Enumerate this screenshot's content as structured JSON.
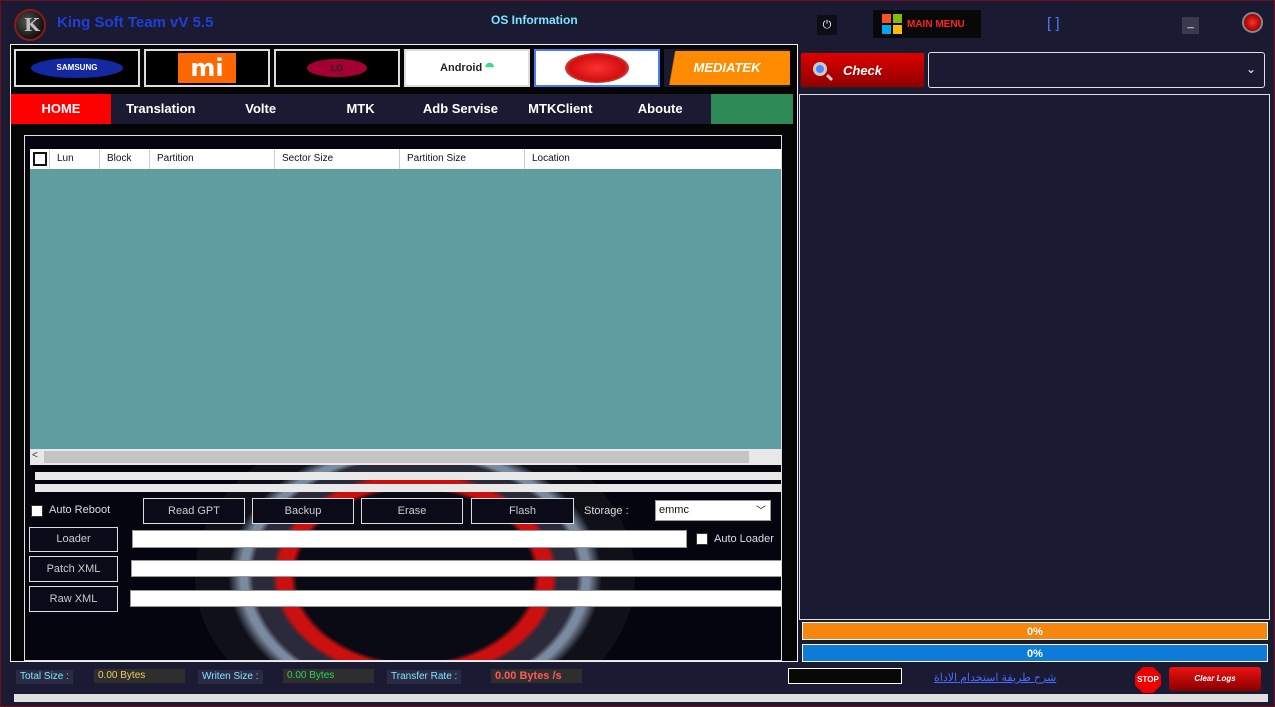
{
  "title_bar": {
    "app_title": "King Soft Team vV 5.5",
    "os_info": "OS Information",
    "main_menu_label": "MAIN MENU",
    "bracket_label": "[ ]",
    "minimize_label": "_",
    "power_glyph": "⏻"
  },
  "brands": {
    "samsung": "SAMSUNG",
    "xiaomi": "mi",
    "lg": "LG",
    "android": "Android",
    "mediatek": "MEDIATEK"
  },
  "nav": {
    "tabs": [
      "HOME",
      "Translation",
      "Volte",
      "MTK",
      "Adb Servise",
      "MTKClient",
      "Aboute"
    ],
    "active_index": 0
  },
  "partition_table": {
    "columns": [
      "Lun",
      "Block",
      "Partition",
      "Sector Size",
      "Partition Size",
      "Location"
    ],
    "rows": []
  },
  "controls": {
    "auto_reboot_label": "Auto Reboot",
    "read_gpt": "Read GPT",
    "backup": "Backup",
    "erase": "Erase",
    "flash": "Flash",
    "storage_label": "Storage :",
    "storage_value": "emmc",
    "loader": "Loader",
    "auto_loader_label": "Auto Loader",
    "patch_xml": "Patch XML",
    "raw_xml": "Raw XML",
    "loader_path": "",
    "patch_path": "",
    "raw_path": ""
  },
  "right_panel": {
    "check_label": "Check",
    "device_dropdown_value": "",
    "progress1_label": "0%",
    "progress1_value": 0,
    "progress2_label": "0%",
    "progress2_value": 0
  },
  "status": {
    "total_size_label": "Total Size :",
    "total_size_value": "0.00 Bytes",
    "written_size_label": "Writen Size :",
    "written_size_value": "0.00 Bytes",
    "transfer_rate_label": "Transfer Rate :",
    "transfer_rate_value": "0.00 Bytes /s",
    "help_link": "شرح طريقة استخدام الاداة",
    "stop_label": "STOP",
    "clear_logs": "Clear Logs"
  },
  "colors": {
    "accent_red": "#ff0000",
    "progress_orange": "#f7860e",
    "progress_blue": "#0f7bd8",
    "table_body": "#5f9ea0",
    "nav_green": "#2e8b57"
  }
}
